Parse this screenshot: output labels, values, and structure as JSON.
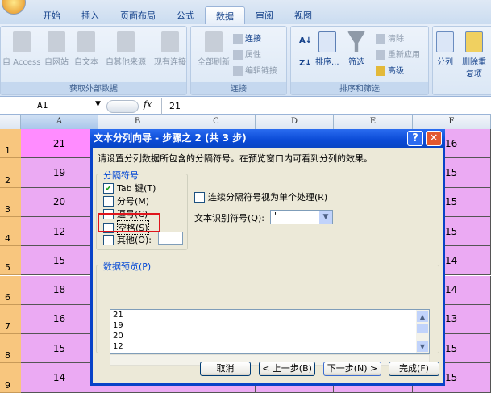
{
  "ribbon": {
    "tabs": [
      "开始",
      "插入",
      "页面布局",
      "公式",
      "数据",
      "审阅",
      "视图"
    ],
    "active_tab": "数据",
    "groups": {
      "external": {
        "label": "获取外部数据",
        "buttons": [
          "自 Access",
          "自网站",
          "自文本",
          "自其他来源",
          "现有连接"
        ]
      },
      "connections": {
        "label": "连接",
        "refresh": "全部刷新",
        "items": [
          "连接",
          "属性",
          "编辑链接"
        ]
      },
      "sort_filter": {
        "label": "排序和筛选",
        "sort": "排序...",
        "filter": "筛选",
        "items": [
          "清除",
          "重新应用",
          "高级"
        ]
      },
      "tools": {
        "split": "分列",
        "dedupe": "删除重复项"
      }
    }
  },
  "formula_bar": {
    "name_box": "A1",
    "fx": "fx",
    "value": "21"
  },
  "sheet": {
    "columns": [
      "A",
      "B",
      "C",
      "D",
      "E",
      "F"
    ],
    "rows": [
      "1",
      "2",
      "3",
      "4",
      "5",
      "6",
      "7",
      "8",
      "9"
    ],
    "col_a": [
      "21",
      "19",
      "20",
      "12",
      "15",
      "18",
      "16",
      "15",
      "14"
    ],
    "col_f": [
      "16",
      "15",
      "15",
      "15",
      "14",
      "14",
      "13",
      "15",
      "15"
    ]
  },
  "dialog": {
    "title": "文本分列向导 - 步骤之 2 (共 3 步)",
    "help": "?",
    "close": "✕",
    "description": "请设置分列数据所包含的分隔符号。在预览窗口内可看到分列的效果。",
    "delimiters_label": "分隔符号",
    "delimiters": [
      {
        "label": "Tab 键(T)",
        "checked": true
      },
      {
        "label": "分号(M)",
        "checked": false
      },
      {
        "label": "逗号(C)",
        "checked": false
      },
      {
        "label": "空格(S)",
        "checked": false
      },
      {
        "label": "其他(O):",
        "checked": false
      }
    ],
    "consecutive": "连续分隔符号视为单个处理(R)",
    "qualifier_label": "文本识别符号(Q):",
    "qualifier_value": "\"",
    "preview_label": "数据预览(P)",
    "preview_lines": [
      "21",
      "19",
      "20",
      "12"
    ],
    "buttons": {
      "cancel": "取消",
      "back": "< 上一步(B)",
      "next": "下一步(N) >",
      "finish": "完成(F)"
    }
  }
}
